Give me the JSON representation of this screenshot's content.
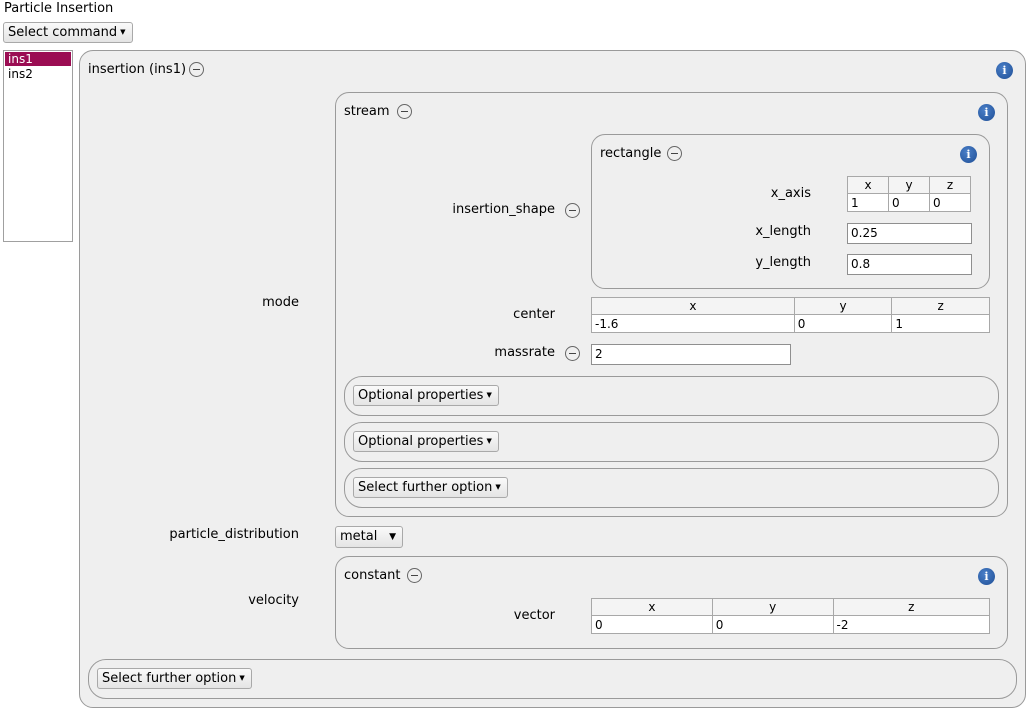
{
  "window": {
    "title": "Particle Insertion"
  },
  "toolbar": {
    "select_command": "Select command"
  },
  "list": {
    "items": [
      {
        "label": "ins1",
        "selected": true
      },
      {
        "label": "ins2",
        "selected": false
      }
    ]
  },
  "insertion": {
    "title": "insertion (ins1)",
    "mode_label": "mode",
    "stream": {
      "title": "stream",
      "insertion_shape_label": "insertion_shape",
      "rectangle": {
        "title": "rectangle",
        "x_axis_label": "x_axis",
        "x_axis": {
          "headers": [
            "x",
            "y",
            "z"
          ],
          "values": [
            "1",
            "0",
            "0"
          ]
        },
        "x_length_label": "x_length",
        "x_length": "0.25",
        "y_length_label": "y_length",
        "y_length": "0.8"
      },
      "center_label": "center",
      "center": {
        "headers": [
          "x",
          "y",
          "z"
        ],
        "values": [
          "-1.6",
          "0",
          "1"
        ]
      },
      "massrate_label": "massrate",
      "massrate": "2",
      "optional_1": "Optional properties",
      "optional_2": "Optional properties",
      "further_option": "Select further option"
    },
    "particle_distribution_label": "particle_distribution",
    "particle_distribution": "metal",
    "velocity_label": "velocity",
    "constant": {
      "title": "constant",
      "vector_label": "vector",
      "vector": {
        "headers": [
          "x",
          "y",
          "z"
        ],
        "values": [
          "0",
          "0",
          "-2"
        ]
      }
    },
    "further_option": "Select further option"
  },
  "colors": {
    "selection": "#9b0d53",
    "panel_bg": "#efefef",
    "info_icon": "#1f4f96"
  }
}
